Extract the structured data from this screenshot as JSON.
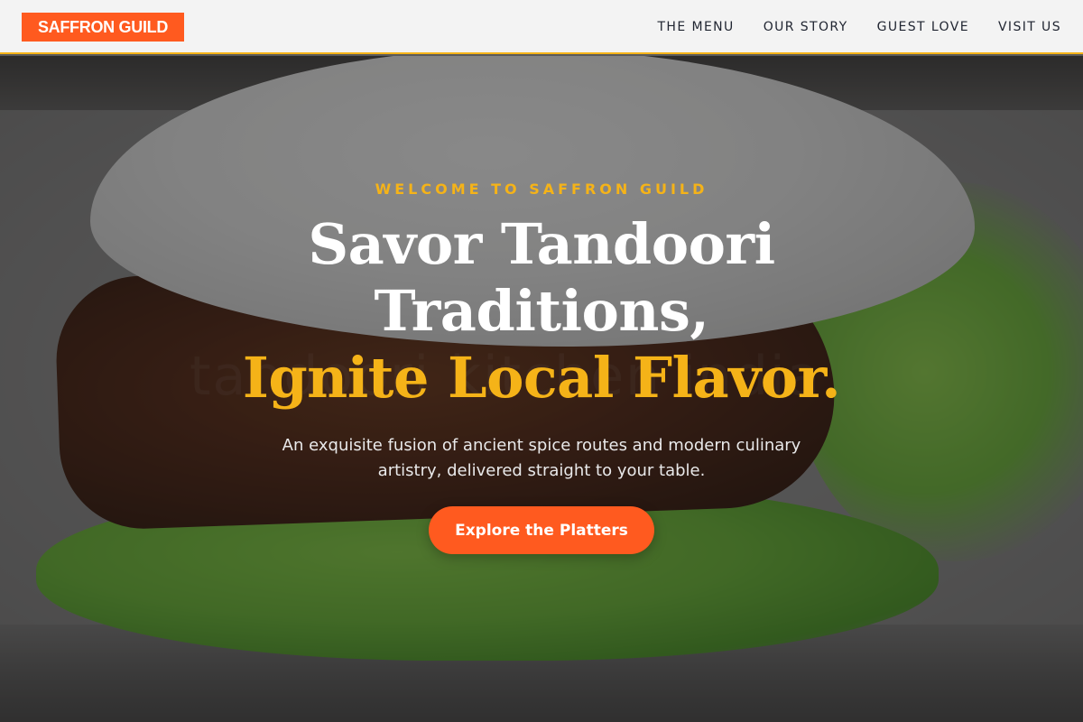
{
  "brand": {
    "name": "SAFFRON GUILD",
    "primary_color": "#ff5a1f",
    "accent_color": "#f5b318"
  },
  "nav": {
    "items": [
      {
        "label": "THE MENU"
      },
      {
        "label": "OUR STORY"
      },
      {
        "label": "GUEST LOVE"
      },
      {
        "label": "VISIT US"
      }
    ]
  },
  "hero": {
    "eyebrow": "WELCOME TO SAFFRON GUILD",
    "headline_line1": "Savor Tandoori",
    "headline_line2": "Traditions,",
    "headline_line3": "Ignite Local Flavor.",
    "subtitle": "An exquisite fusion of ancient spice routes and modern culinary artistry, delivered straight to your table.",
    "cta_label": "Explore the Platters",
    "background_image": "burger-with-lettuce-photo",
    "watermark_text": "tandoori kitchen india"
  }
}
